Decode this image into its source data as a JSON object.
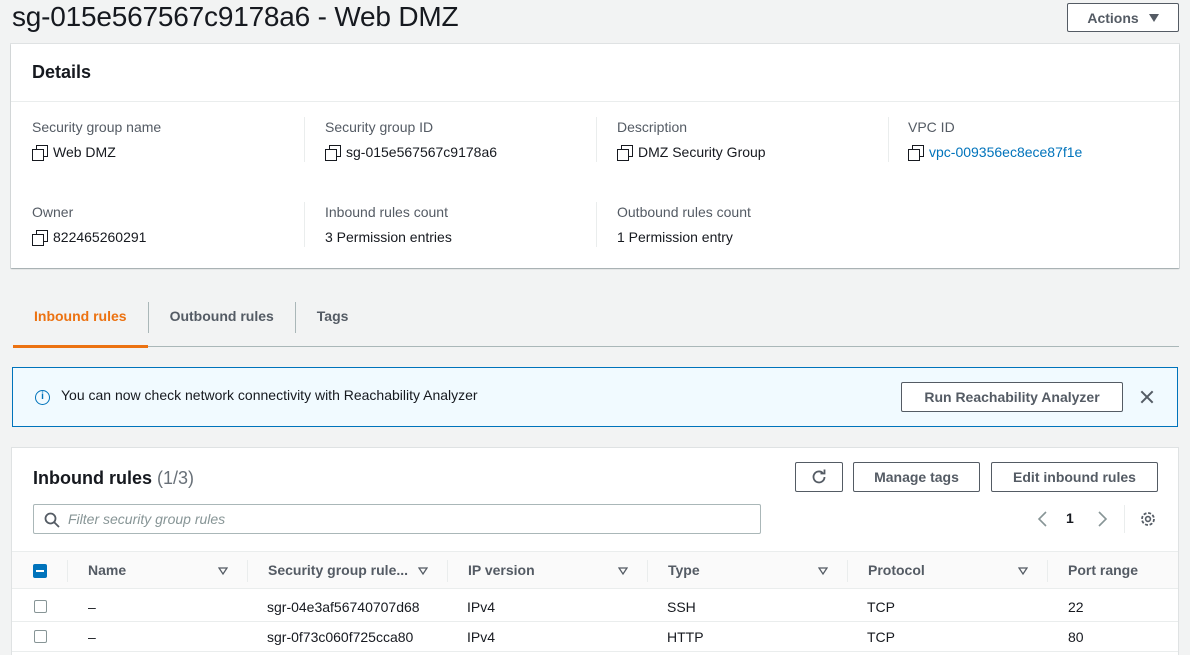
{
  "page": {
    "title": "sg-015e567567c9178a6 - Web DMZ",
    "actions_label": "Actions"
  },
  "details": {
    "title": "Details",
    "fields": {
      "sg_name": {
        "label": "Security group name",
        "value": "Web DMZ"
      },
      "sg_id": {
        "label": "Security group ID",
        "value": "sg-015e567567c9178a6"
      },
      "description": {
        "label": "Description",
        "value": "DMZ Security Group"
      },
      "vpc_id": {
        "label": "VPC ID",
        "value": "vpc-009356ec8ece87f1e"
      },
      "owner": {
        "label": "Owner",
        "value": "822465260291"
      },
      "inbound_count": {
        "label": "Inbound rules count",
        "value": "3 Permission entries"
      },
      "outbound_count": {
        "label": "Outbound rules count",
        "value": "1 Permission entry"
      }
    }
  },
  "tabs": [
    {
      "label": "Inbound rules",
      "active": true
    },
    {
      "label": "Outbound rules",
      "active": false
    },
    {
      "label": "Tags",
      "active": false
    }
  ],
  "banner": {
    "text": "You can now check network connectivity with Reachability Analyzer",
    "button_label": "Run Reachability Analyzer"
  },
  "rules": {
    "title": "Inbound rules",
    "count": "(1/3)",
    "manage_tags_label": "Manage tags",
    "edit_label": "Edit inbound rules",
    "search_placeholder": "Filter security group rules",
    "page_number": "1",
    "columns": {
      "name": "Name",
      "rule_id": "Security group rule...",
      "ip_version": "IP version",
      "type": "Type",
      "protocol": "Protocol",
      "port_range": "Port range"
    },
    "rows": [
      {
        "name": "–",
        "rule_id": "sgr-04e3af56740707d68",
        "ip_version": "IPv4",
        "type": "SSH",
        "protocol": "TCP",
        "port_range": "22"
      },
      {
        "name": "–",
        "rule_id": "sgr-0f73c060f725cca80",
        "ip_version": "IPv4",
        "type": "HTTP",
        "protocol": "TCP",
        "port_range": "80"
      }
    ]
  },
  "colors": {
    "accent": "#ec7211",
    "link": "#0073bb",
    "text": "#16191f",
    "secondary_text": "#545b64"
  }
}
